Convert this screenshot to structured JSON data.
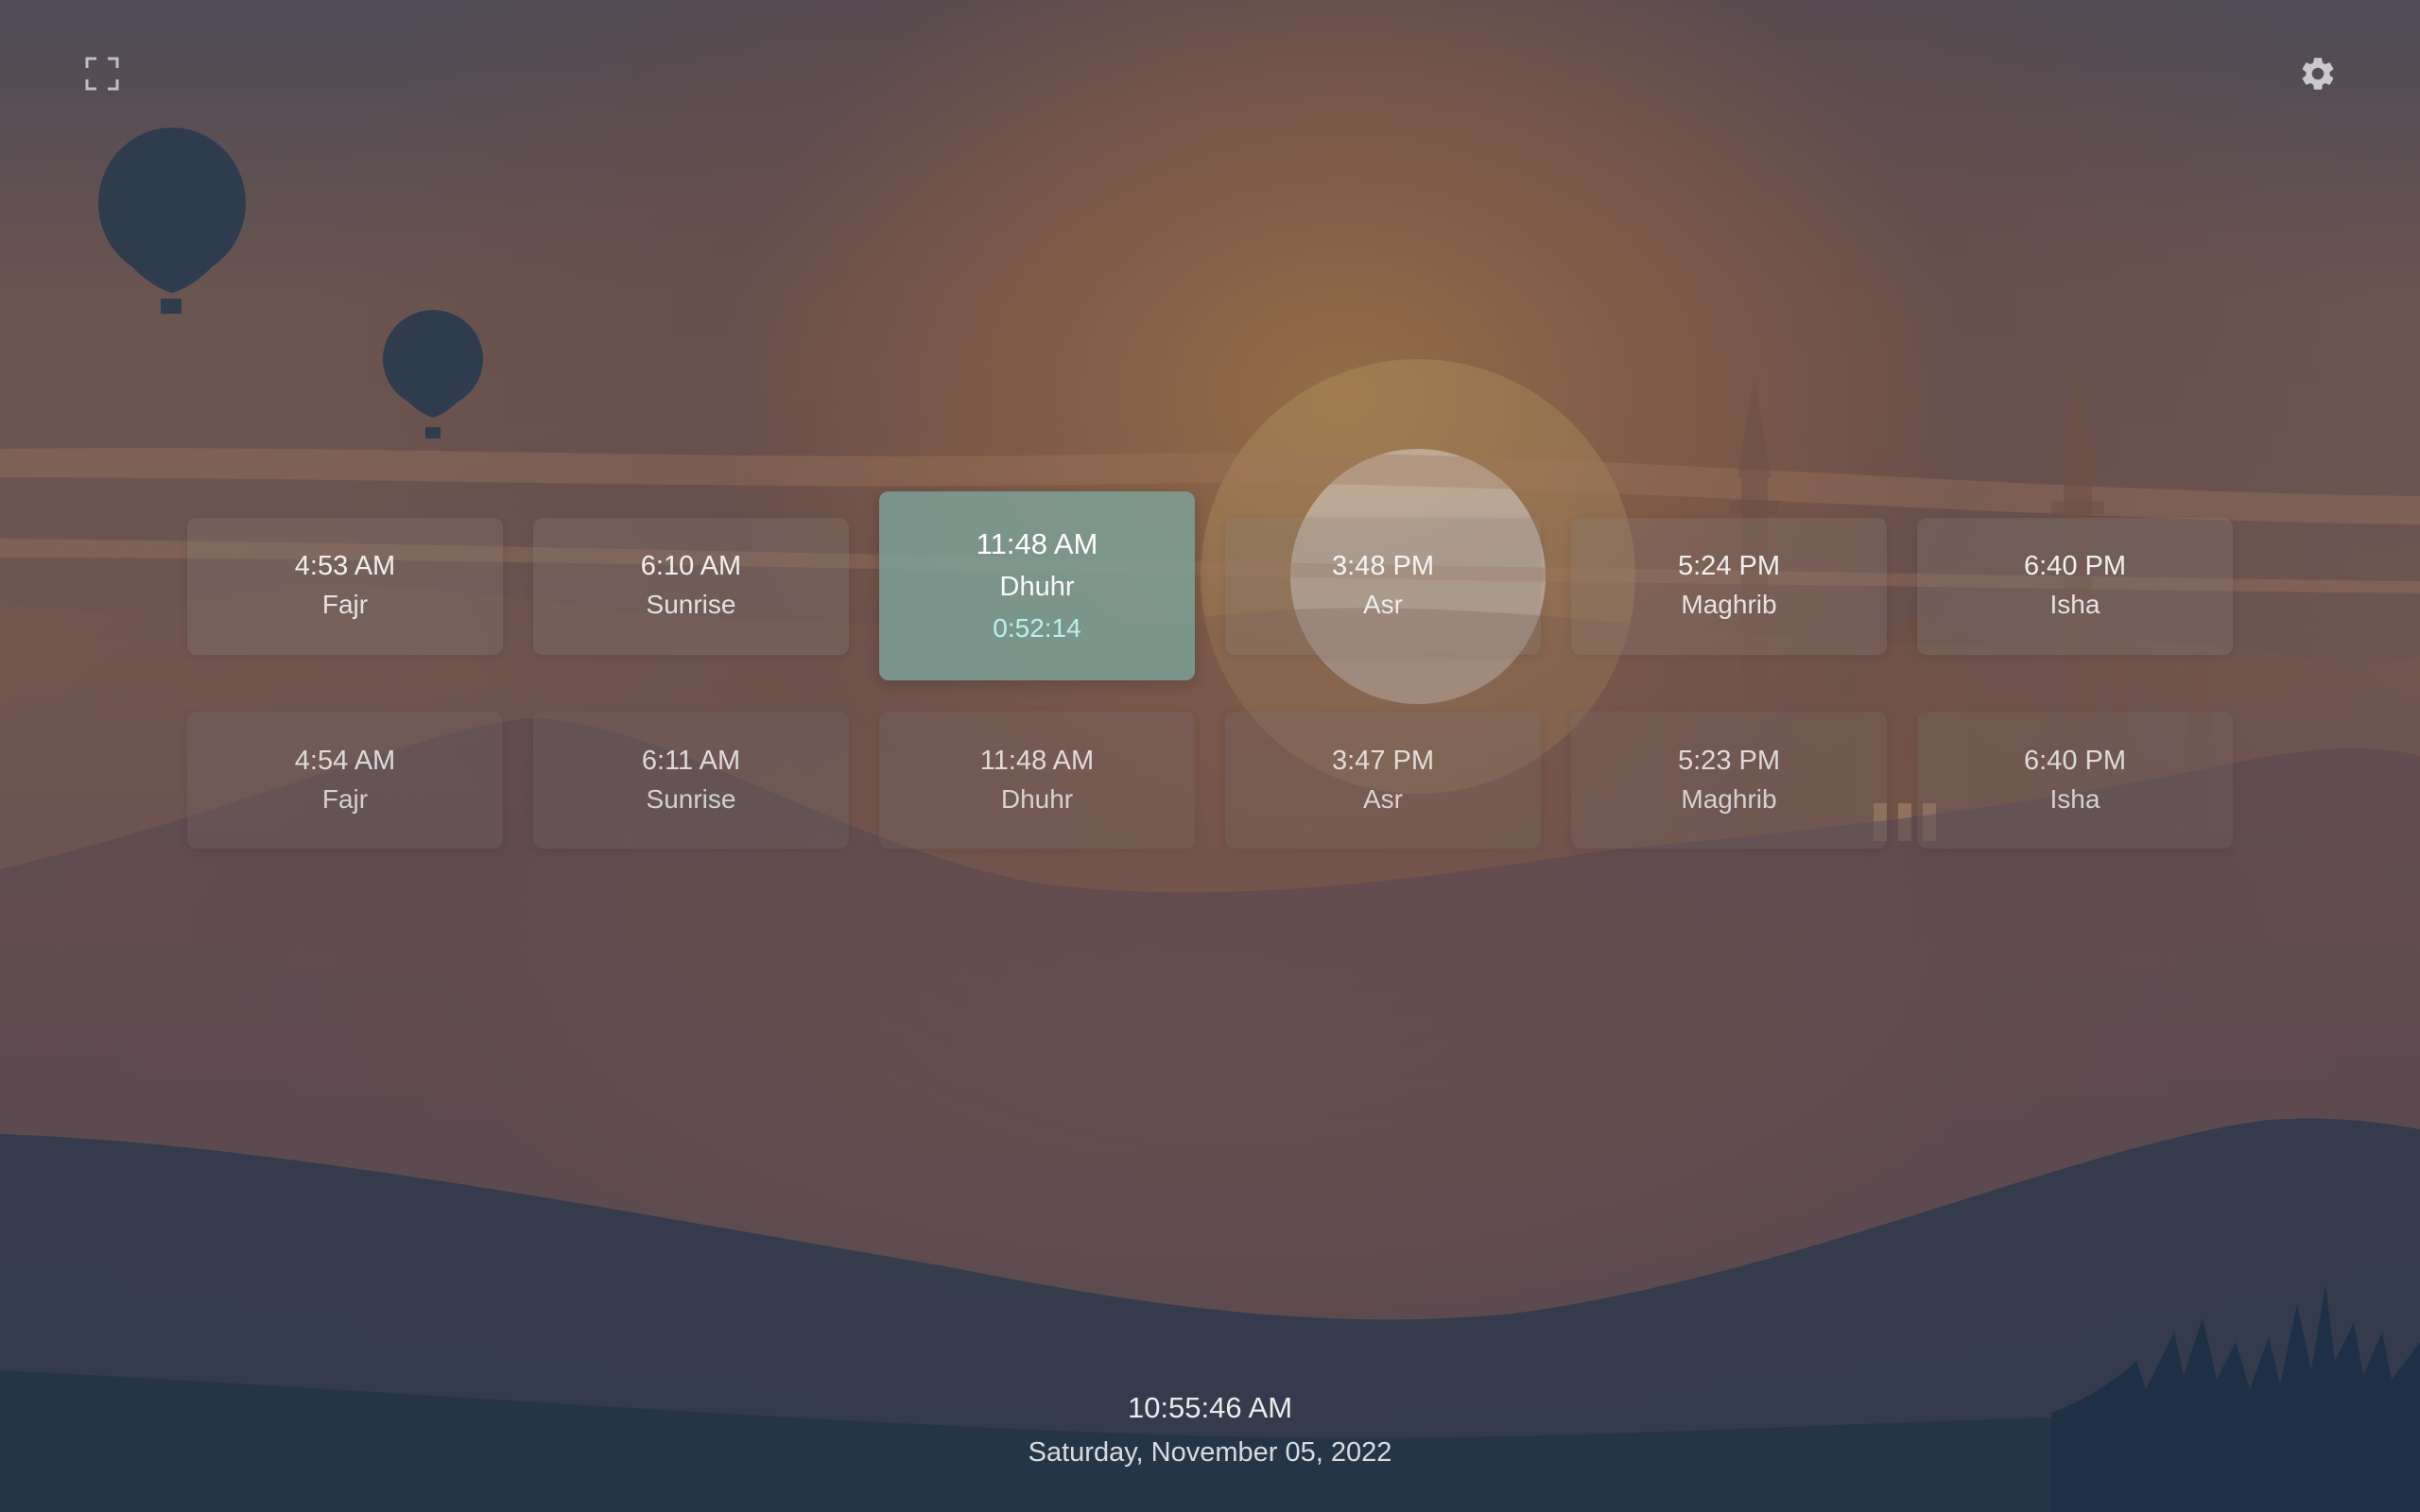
{
  "icons": {
    "fullscreen": "fullscreen-icon",
    "settings": "gear-icon"
  },
  "today": [
    {
      "time": "4:53 AM",
      "name": "Fajr"
    },
    {
      "time": "6:10 AM",
      "name": "Sunrise"
    },
    {
      "time": "11:48 AM",
      "name": "Dhuhr",
      "countdown": "0:52:14"
    },
    {
      "time": "3:48 PM",
      "name": "Asr"
    },
    {
      "time": "5:24 PM",
      "name": "Maghrib"
    },
    {
      "time": "6:40 PM",
      "name": "Isha"
    }
  ],
  "tomorrow": [
    {
      "time": "4:54 AM",
      "name": "Fajr"
    },
    {
      "time": "6:11 AM",
      "name": "Sunrise"
    },
    {
      "time": "11:48 AM",
      "name": "Dhuhr"
    },
    {
      "time": "3:47 PM",
      "name": "Asr"
    },
    {
      "time": "5:23 PM",
      "name": "Maghrib"
    },
    {
      "time": "6:40 PM",
      "name": "Isha"
    }
  ],
  "active_prayer": "Dhuhr",
  "clock": {
    "time": "10:55:46 AM",
    "date": "Saturday, November 05, 2022"
  },
  "colors": {
    "active_card": "#7da096",
    "countdown": "#b9f0ec",
    "dune_dark": "#253548"
  }
}
